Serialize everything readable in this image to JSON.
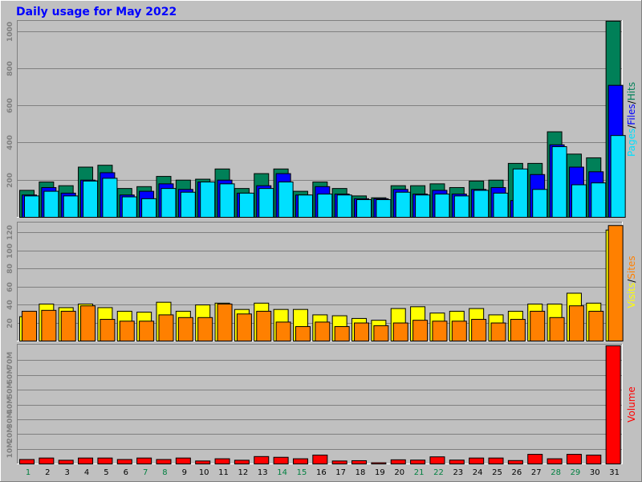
{
  "chart_data": {
    "type": "bar",
    "title": "Daily usage for May 2022",
    "days": [
      "1",
      "2",
      "3",
      "4",
      "5",
      "6",
      "7",
      "8",
      "9",
      "10",
      "11",
      "12",
      "13",
      "14",
      "15",
      "16",
      "17",
      "18",
      "19",
      "20",
      "21",
      "22",
      "23",
      "24",
      "25",
      "26",
      "27",
      "28",
      "29",
      "30",
      "31"
    ],
    "weekend_days": [
      "1",
      "7",
      "8",
      "14",
      "15",
      "21",
      "22",
      "28",
      "29"
    ],
    "panels": [
      {
        "id": "hits",
        "ylim": [
          0,
          1050
        ],
        "yticks": [
          200,
          400,
          600,
          800,
          1000
        ],
        "ytick_labels": [
          "200",
          "400",
          "600",
          "800",
          "1000"
        ],
        "legend": [
          "Pages",
          "Files",
          "Hits"
        ],
        "series": [
          {
            "name": "Hits",
            "color": "#008058",
            "values": [
              145,
              190,
              170,
              270,
              280,
              155,
              165,
              220,
              200,
              205,
              260,
              155,
              235,
              260,
              140,
              190,
              155,
              115,
              105,
              170,
              170,
              180,
              160,
              195,
              200,
              290,
              290,
              460,
              340,
              320,
              1055
            ]
          },
          {
            "name": "Files",
            "color": "#0000ff",
            "values": [
              120,
              160,
              130,
              200,
              240,
              120,
              140,
              180,
              150,
              190,
              200,
              130,
              170,
              235,
              120,
              165,
              125,
              100,
              100,
              150,
              125,
              145,
              125,
              150,
              160,
              90,
              230,
              390,
              270,
              245,
              710
            ]
          },
          {
            "name": "Pages",
            "color": "#00e0ff",
            "values": [
              115,
              140,
              115,
              195,
              210,
              110,
              100,
              155,
              135,
              190,
              180,
              130,
              155,
              190,
              120,
              125,
              120,
              95,
              95,
              135,
              120,
              125,
              115,
              145,
              130,
              260,
              150,
              380,
              175,
              185,
              440
            ]
          }
        ]
      },
      {
        "id": "visits",
        "ylim": [
          0,
          130
        ],
        "yticks": [
          20,
          40,
          60,
          80,
          100,
          120
        ],
        "ytick_labels": [
          "20",
          "40",
          "60",
          "80",
          "100",
          "120"
        ],
        "legend": [
          "Visits",
          "Sites"
        ],
        "series": [
          {
            "name": "Visits",
            "color": "#ffff00",
            "values": [
              27,
              41,
              37,
              41,
              37,
              33,
              32,
              43,
              33,
              40,
              42,
              35,
              42,
              35,
              35,
              29,
              28,
              25,
              23,
              36,
              38,
              31,
              33,
              36,
              29,
              33,
              41,
              41,
              53,
              42,
              123
            ]
          },
          {
            "name": "Sites",
            "color": "#ff8000",
            "values": [
              33,
              34,
              33,
              39,
              24,
              22,
              22,
              29,
              26,
              26,
              41,
              30,
              33,
              21,
              16,
              21,
              16,
              20,
              17,
              20,
              23,
              22,
              22,
              24,
              20,
              24,
              33,
              26,
              39,
              33,
              128
            ]
          }
        ]
      },
      {
        "id": "volume",
        "ylim": [
          0,
          80
        ],
        "yticks": [
          10,
          20,
          30,
          40,
          50,
          60,
          70
        ],
        "ytick_labels": [
          "10M",
          "20M",
          "30M",
          "40M",
          "50M",
          "60M",
          "70M"
        ],
        "legend": [
          "Volume"
        ],
        "series": [
          {
            "name": "Volume",
            "color": "#ff0000",
            "values": [
              3,
              4,
              2.5,
              4,
              4,
              3,
              4,
              3,
              4,
              2,
              3.5,
              2.5,
              5,
              4.5,
              3.5,
              6,
              2,
              2.2,
              0.8,
              2.8,
              2.6,
              4.8,
              2.6,
              4,
              4,
              2.3,
              6.5,
              3.5,
              6.5,
              6,
              80
            ]
          }
        ]
      }
    ],
    "colors": {
      "background": "#c0c0c0",
      "title": "#0000ff",
      "tick": "#808080",
      "weekday": "#000000",
      "weekend": "#008040",
      "grid": "#808080"
    }
  }
}
